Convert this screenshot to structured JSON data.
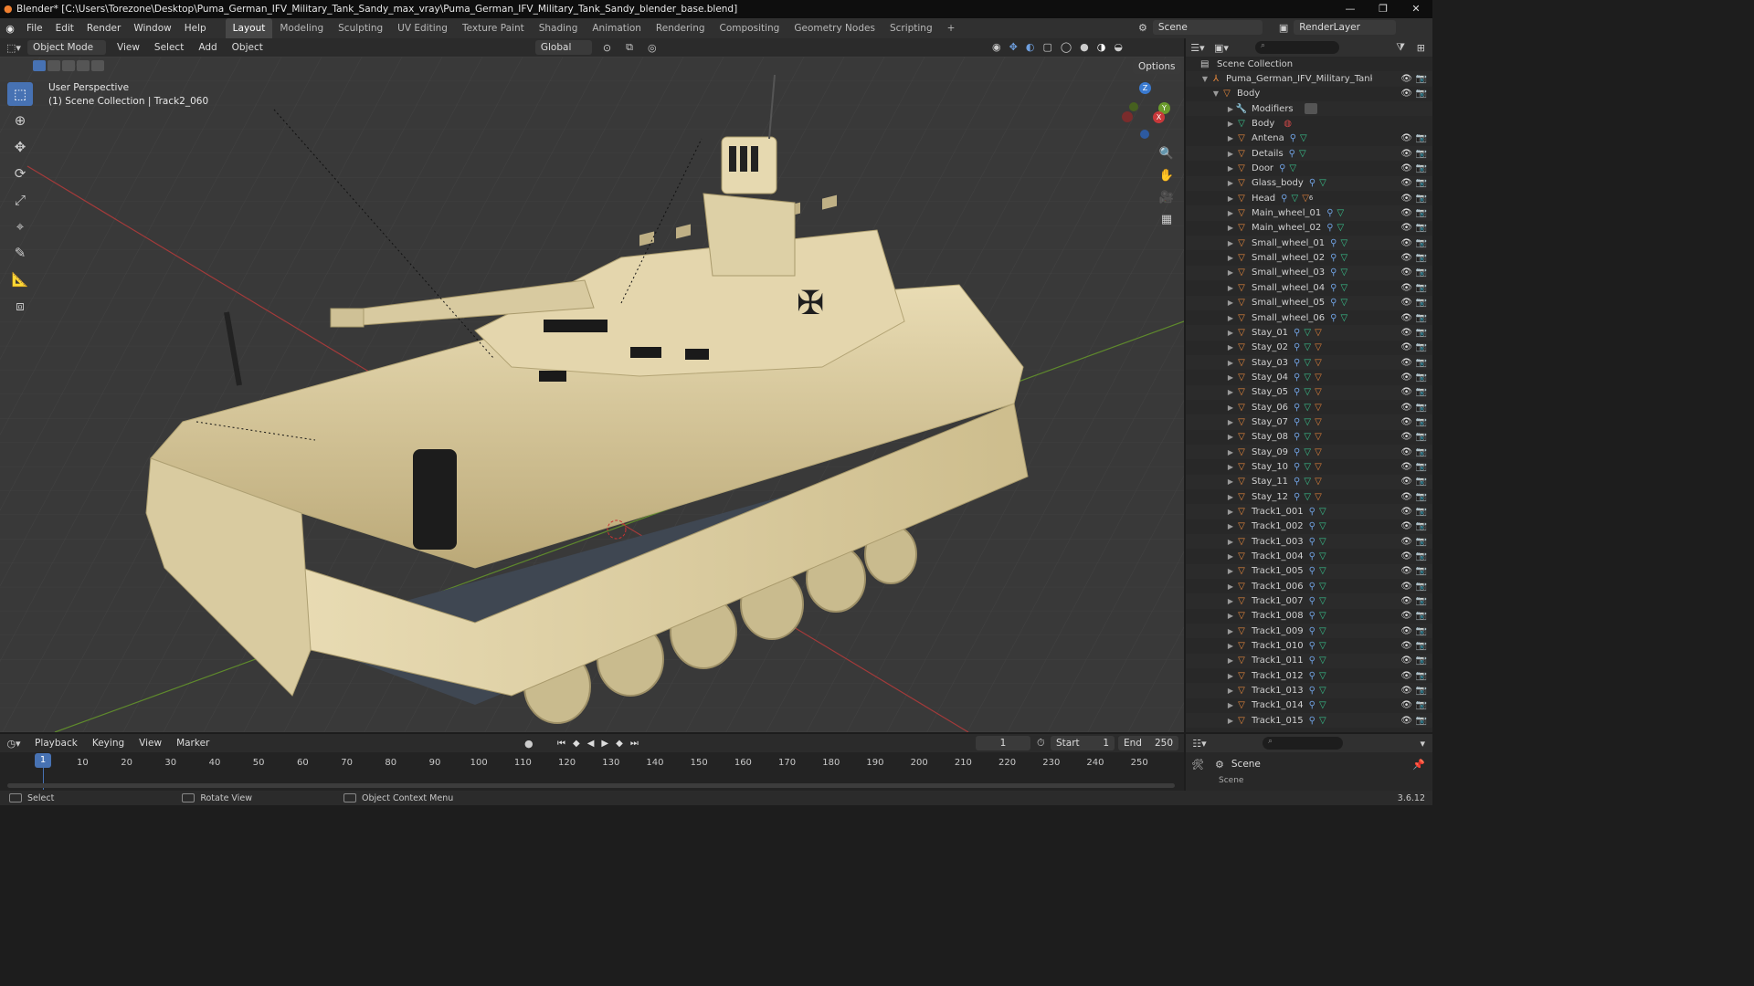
{
  "window": {
    "title": "Blender* [C:\\Users\\Torezone\\Desktop\\Puma_German_IFV_Military_Tank_Sandy_max_vray\\Puma_German_IFV_Military_Tank_Sandy_blender_base.blend]",
    "minimize": "—",
    "maximize": "❐",
    "close": "✕"
  },
  "menu": [
    "File",
    "Edit",
    "Render",
    "Window",
    "Help"
  ],
  "workspaces": [
    "Layout",
    "Modeling",
    "Sculpting",
    "UV Editing",
    "Texture Paint",
    "Shading",
    "Animation",
    "Rendering",
    "Compositing",
    "Geometry Nodes",
    "Scripting"
  ],
  "active_workspace": "Layout",
  "scene_selector": {
    "scene": "Scene",
    "render_layer": "RenderLayer"
  },
  "viewport": {
    "mode": "Object Mode",
    "menus": [
      "View",
      "Select",
      "Add",
      "Object"
    ],
    "transform_orientation": "Global",
    "options_label": "Options",
    "overlay_line1": "User Perspective",
    "overlay_line2": "(1) Scene Collection | Track2_060",
    "gizmo_axes": {
      "x": "X",
      "y": "Y",
      "z": "Z"
    }
  },
  "outliner": {
    "scene_collection": "Scene Collection",
    "root_object": "Puma_German_IFV_Military_Tank_Sandy",
    "body": "Body",
    "modifiers": "Modifiers",
    "body_mesh": "Body",
    "children": [
      "Antena",
      "Details",
      "Door",
      "Glass_body",
      "Head",
      "Main_wheel_01",
      "Main_wheel_02",
      "Small_wheel_01",
      "Small_wheel_02",
      "Small_wheel_03",
      "Small_wheel_04",
      "Small_wheel_05",
      "Small_wheel_06",
      "Stay_01",
      "Stay_02",
      "Stay_03",
      "Stay_04",
      "Stay_05",
      "Stay_06",
      "Stay_07",
      "Stay_08",
      "Stay_09",
      "Stay_10",
      "Stay_11",
      "Stay_12",
      "Track1_001",
      "Track1_002",
      "Track1_003",
      "Track1_004",
      "Track1_005",
      "Track1_006",
      "Track1_007",
      "Track1_008",
      "Track1_009",
      "Track1_010",
      "Track1_011",
      "Track1_012",
      "Track1_013",
      "Track1_014",
      "Track1_015"
    ],
    "head_badge": "6"
  },
  "timeline": {
    "menus": [
      "Playback",
      "Keying",
      "View",
      "Marker"
    ],
    "current_frame": "1",
    "start_label": "Start",
    "start_value": "1",
    "end_label": "End",
    "end_value": "250",
    "ruler": [
      "1",
      "10",
      "20",
      "30",
      "40",
      "50",
      "60",
      "70",
      "80",
      "90",
      "100",
      "110",
      "120",
      "130",
      "140",
      "150",
      "160",
      "170",
      "180",
      "190",
      "200",
      "210",
      "220",
      "230",
      "240",
      "250"
    ]
  },
  "properties": {
    "scene_label": "Scene",
    "sub_label": "Scene"
  },
  "status": {
    "select": "Select",
    "rotate": "Rotate View",
    "context": "Object Context Menu",
    "version": "3.6.12"
  },
  "colors": {
    "accent": "#4772b3",
    "tank": "#d8c89a",
    "x_axis": "#c8383a",
    "y_axis": "#6a9a2c",
    "z_axis": "#3a7ad0"
  }
}
